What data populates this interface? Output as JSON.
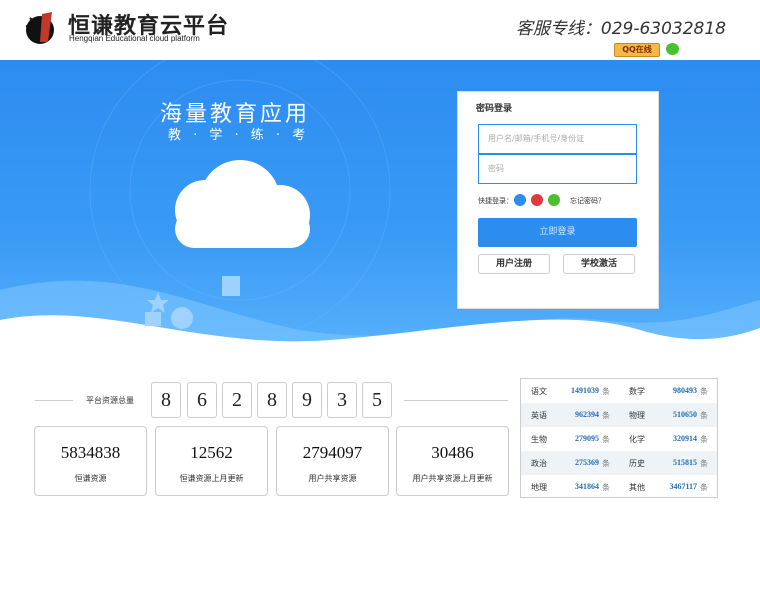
{
  "header": {
    "brand_cn": "恒谦教育云平台",
    "brand_en": "Hengqian Educational cloud platform",
    "hotline": "客服专线：029-63032818",
    "qq_badge": "QQ在线"
  },
  "banner": {
    "slogan": "海量教育应用",
    "slogan_sub": "教 · 学 · 练 · 考"
  },
  "login": {
    "title": "密码登录",
    "username_placeholder": "用户名/邮箱/手机号/身份证",
    "password_placeholder": "密码",
    "quick_login": "快捷登录：",
    "forgot": "忘记密码？",
    "submit": "立即登录",
    "register": "用户注册",
    "activate": "学校激活"
  },
  "counter": {
    "label": "平台资源总量",
    "digits": [
      "8",
      "6",
      "2",
      "8",
      "9",
      "3",
      "5"
    ]
  },
  "stats": [
    {
      "num": "5834838",
      "label": "恒谦资源"
    },
    {
      "num": "12562",
      "label": "恒谦资源上月更新"
    },
    {
      "num": "2794097",
      "label": "用户共享资源"
    },
    {
      "num": "30486",
      "label": "用户共享资源上月更新"
    }
  ],
  "subjects": [
    {
      "a_name": "语文",
      "a_val": "1491039",
      "a_unit": "条",
      "b_name": "数学",
      "b_val": "980493",
      "b_unit": "条"
    },
    {
      "a_name": "英语",
      "a_val": "962394",
      "a_unit": "条",
      "b_name": "物理",
      "b_val": "510650",
      "b_unit": "条"
    },
    {
      "a_name": "生物",
      "a_val": "279095",
      "a_unit": "条",
      "b_name": "化学",
      "b_val": "320914",
      "b_unit": "条"
    },
    {
      "a_name": "政治",
      "a_val": "275369",
      "a_unit": "条",
      "b_name": "历史",
      "b_val": "515815",
      "b_unit": "条"
    },
    {
      "a_name": "地理",
      "a_val": "341864",
      "a_unit": "条",
      "b_name": "其他",
      "b_val": "3467117",
      "b_unit": "条"
    }
  ],
  "colors": {
    "primary": "#2d8cf0",
    "value_blue": "#1f6fb5"
  }
}
